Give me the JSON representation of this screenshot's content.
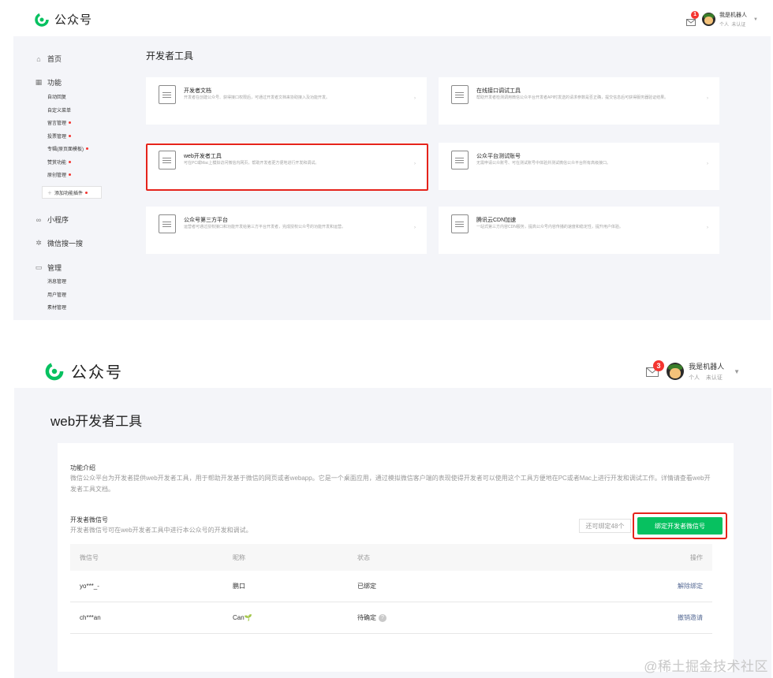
{
  "shot1": {
    "brand": "公众号",
    "mail_count": "1",
    "user_name": "我是机器人",
    "user_type": "个人",
    "user_status": "未认证",
    "sidebar": {
      "home": "首页",
      "features": "功能",
      "feature_items": [
        {
          "label": "自动回复",
          "dot": false
        },
        {
          "label": "自定义菜单",
          "dot": false
        },
        {
          "label": "留言管理",
          "dot": true
        },
        {
          "label": "投票管理",
          "dot": true
        },
        {
          "label": "专辑(原页面模板)",
          "dot": true
        },
        {
          "label": "赞赏功能",
          "dot": true
        },
        {
          "label": "原创管理",
          "dot": true
        }
      ],
      "add_plugin": "添加功能插件",
      "miniprogram": "小程序",
      "wechat_search": "微信搜一搜",
      "manage": "管理",
      "manage_items": [
        "消息管理",
        "用户管理",
        "素材管理"
      ]
    },
    "title": "开发者工具",
    "cards": [
      {
        "title": "开发者文档",
        "desc": "开发者在创建公众号、获得接口权限后，可通过开发者文档来协助接入及功能开发。"
      },
      {
        "title": "在线接口调试工具",
        "desc": "帮助开发者检测调用微信公众平台开发者API时发送的请求参数是否正确，提交信息后可获得服务器验证结果。"
      },
      {
        "title": "web开发者工具",
        "desc": "可在PC或Mac上模拟访问微信内网页，帮助开发者更方便地进行开发和调试。"
      },
      {
        "title": "公众平台测试账号",
        "desc": "无需申请公众账号、可在测试账号中体验并测试微信公众平台所有高级接口。"
      },
      {
        "title": "公众号第三方平台",
        "desc": "运营者可通过授权接口和功能开发给第三方平台开发者，完成授权公众号的功能开发和运营。"
      },
      {
        "title": "腾讯云CDN加速",
        "desc": "一站式第三方内容CDN服务，提高公众号内容传播的速度和稳定性，提升用户体验。"
      }
    ]
  },
  "shot2": {
    "brand": "公众号",
    "mail_count": "3",
    "user_name": "我是机器人",
    "user_type": "个人",
    "user_status": "未认证",
    "page_title": "web开发者工具",
    "intro_label": "功能介绍",
    "intro_desc": "微信公众平台为开发者提供web开发者工具，用于帮助开发基于微信的网页或者webapp。它是一个桌面应用，通过模拟微信客户端的表现使得开发者可以使用这个工具方便地在PC或者Mac上进行开发和调试工作。详情请查看web开发者工具文档。",
    "wx_label": "开发者微信号",
    "wx_desc": "开发者微信号可在web开发者工具中进行本公众号的开发和调试。",
    "quota": "还可绑定48个",
    "bind_button": "绑定开发者微信号",
    "table": {
      "headers": [
        "微信号",
        "昵称",
        "状态",
        "操作"
      ],
      "rows": [
        {
          "wxid": "yo***_-",
          "nick": "鹏口",
          "sprout": "",
          "status": "已绑定",
          "help": false,
          "action": "解除绑定"
        },
        {
          "wxid": "ch***an",
          "nick": "Can",
          "sprout": "🌱",
          "status": "待确定",
          "help": true,
          "action": "撤销邀请"
        }
      ]
    }
  },
  "watermark": "@稀土掘金技术社区",
  "colors": {
    "brand_green": "#07c160",
    "highlight_red": "#e5231b",
    "link_blue": "#576b95",
    "badge_red": "#f43530"
  }
}
